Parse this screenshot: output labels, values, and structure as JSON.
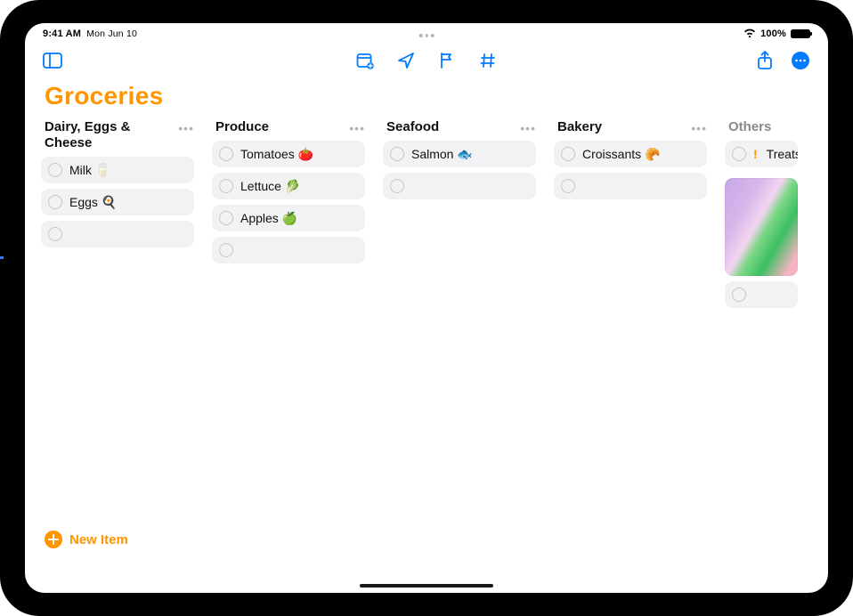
{
  "status": {
    "time": "9:41 AM",
    "date": "Mon Jun 10",
    "battery_pct": "100%"
  },
  "toolbar": {
    "sidebar_icon": "sidebar",
    "calendar_icon": "calendar-add",
    "location_icon": "location-arrow",
    "flag_icon": "flag",
    "tag_icon": "number",
    "share_icon": "share",
    "more_icon": "ellipsis-circle"
  },
  "list": {
    "title": "Groceries",
    "accent_color": "#ff9500"
  },
  "columns": [
    {
      "title": "Dairy, Eggs & Cheese",
      "dim": false,
      "more": "true",
      "items": [
        {
          "label": "Milk 🥛"
        },
        {
          "label": "Eggs 🍳"
        }
      ],
      "has_empty_new_row": true
    },
    {
      "title": "Produce",
      "dim": false,
      "more": "true",
      "items": [
        {
          "label": "Tomatoes 🍅"
        },
        {
          "label": "Lettuce 🥬"
        },
        {
          "label": "Apples 🍏"
        }
      ],
      "has_empty_new_row": true
    },
    {
      "title": "Seafood",
      "dim": false,
      "more": "true",
      "items": [
        {
          "label": "Salmon 🐟"
        }
      ],
      "has_empty_new_row": true
    },
    {
      "title": "Bakery",
      "dim": false,
      "more": "true",
      "items": [
        {
          "label": "Croissants 🥐"
        }
      ],
      "has_empty_new_row": true
    },
    {
      "title": "Others",
      "dim": true,
      "more": "false",
      "partial": true,
      "items": [
        {
          "priority": "!",
          "label": "Treats for t"
        }
      ],
      "has_image_attachment": true,
      "has_empty_new_row": true
    }
  ],
  "footer": {
    "new_item_label": "New Item"
  }
}
